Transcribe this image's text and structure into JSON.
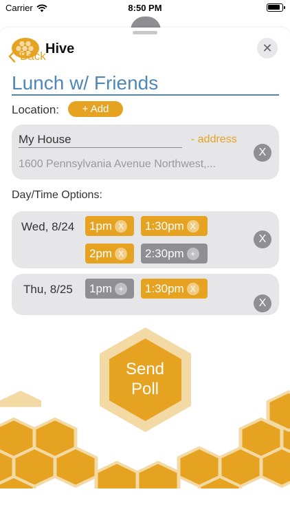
{
  "status_bar": {
    "carrier": "Carrier",
    "time": "8:50 PM"
  },
  "header": {
    "app_title": "Hive",
    "close_label": "✕"
  },
  "nav": {
    "back_label": "Back"
  },
  "event": {
    "title": "Lunch w/ Friends"
  },
  "location": {
    "label": "Location:",
    "add_label": "+ Add",
    "name": "My House",
    "address_link": "- address",
    "address": "1600 Pennsylvania Avenue Northwest,...",
    "remove_label": "X"
  },
  "day_time": {
    "label": "Day/Time Options:",
    "days": [
      {
        "day": "Wed, 8/24",
        "remove_label": "X",
        "slots": [
          {
            "time": "1pm",
            "selected": true,
            "icon": "X"
          },
          {
            "time": "1:30pm",
            "selected": true,
            "icon": "X"
          },
          {
            "time": "2pm",
            "selected": true,
            "icon": "X"
          },
          {
            "time": "2:30pm",
            "selected": false,
            "icon": "+"
          }
        ]
      },
      {
        "day": "Thu, 8/25",
        "remove_label": "X",
        "slots": [
          {
            "time": "1pm",
            "selected": false,
            "icon": "+"
          },
          {
            "time": "1:30pm",
            "selected": true,
            "icon": "X"
          }
        ]
      }
    ]
  },
  "send": {
    "line1": "Send",
    "line2": "Poll"
  },
  "colors": {
    "accent": "#e6a321",
    "accent_light": "#f3d9a4",
    "title_blue": "#4f86b8",
    "card_bg": "#e6e6e8",
    "pill_gray": "#8e8e93"
  }
}
